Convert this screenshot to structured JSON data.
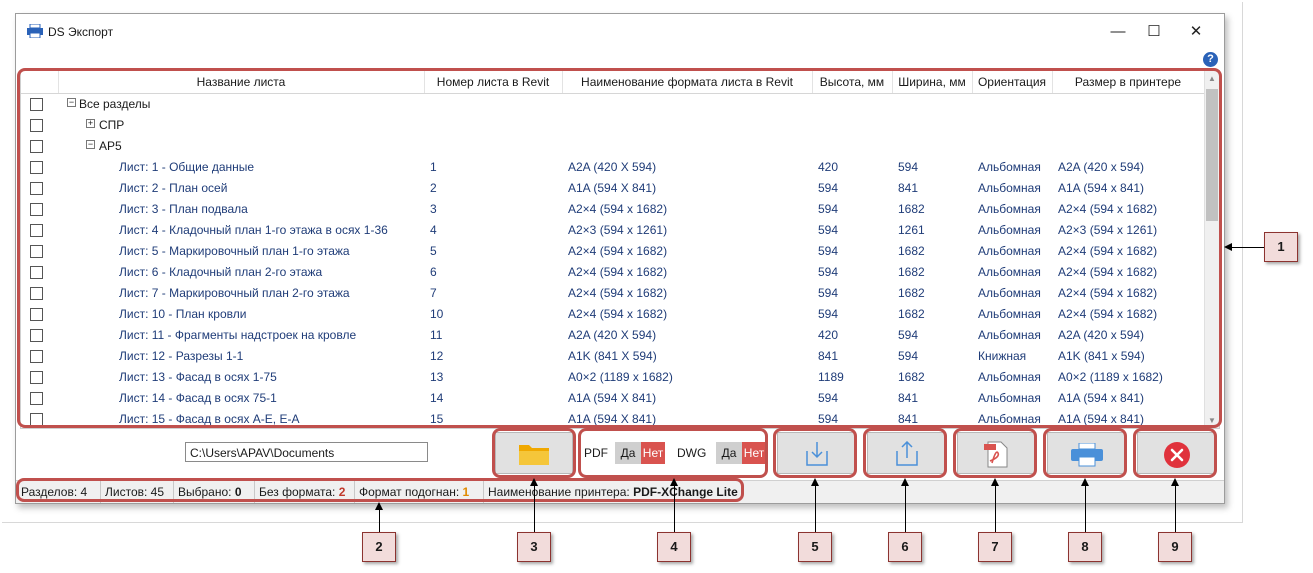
{
  "window": {
    "title": "DS Экспорт",
    "minimize": "—",
    "maximize": "☐",
    "close": "✕",
    "help": "?"
  },
  "colors": {
    "highlight": "#c0504d",
    "callout_fill": "#f2dcdb",
    "toggle_no": "#d9534f",
    "sheet_text": "#1f3c78",
    "folder": "#f5b81c",
    "export_blue": "#4a90d9",
    "close_red": "#e0323c"
  },
  "table": {
    "headers": [
      "Название листа",
      "Номер листа в Revit",
      "Наименование формата листа в Revit",
      "Высота, мм",
      "Ширина, мм",
      "Ориентация",
      "Размер в принтере"
    ],
    "groups": [
      {
        "label": "Все разделы",
        "expander": "−"
      },
      {
        "label": "СПР",
        "expander": "+"
      },
      {
        "label": "АР5",
        "expander": "−"
      }
    ],
    "rows": [
      {
        "name": "Лист: 1 - Общие данные",
        "number": "1",
        "format": "A2A (420 X 594)",
        "height": "420",
        "width": "594",
        "orientation": "Альбомная",
        "printer_size": "A2A (420 x 594)"
      },
      {
        "name": "Лист: 2 - План осей",
        "number": "2",
        "format": "A1A (594 X 841)",
        "height": "594",
        "width": "841",
        "orientation": "Альбомная",
        "printer_size": "A1A (594 x 841)"
      },
      {
        "name": "Лист: 3 - План подвала",
        "number": "3",
        "format": "A2×4 (594 x 1682)",
        "height": "594",
        "width": "1682",
        "orientation": "Альбомная",
        "printer_size": "A2×4 (594 x 1682)"
      },
      {
        "name": "Лист: 4 - Кладочный план 1-го этажа в осях 1-36",
        "number": "4",
        "format": "A2×3 (594 x 1261)",
        "height": "594",
        "width": "1261",
        "orientation": "Альбомная",
        "printer_size": "A2×3 (594 x 1261)"
      },
      {
        "name": "Лист: 5 - Маркировочный план 1-го этажа",
        "number": "5",
        "format": "A2×4 (594 x 1682)",
        "height": "594",
        "width": "1682",
        "orientation": "Альбомная",
        "printer_size": "A2×4 (594 x 1682)"
      },
      {
        "name": "Лист: 6 - Кладочный план 2-го этажа",
        "number": "6",
        "format": "A2×4 (594 x 1682)",
        "height": "594",
        "width": "1682",
        "orientation": "Альбомная",
        "printer_size": "A2×4 (594 x 1682)"
      },
      {
        "name": "Лист: 7 - Маркировочный план 2-го этажа",
        "number": "7",
        "format": "A2×4 (594 x 1682)",
        "height": "594",
        "width": "1682",
        "orientation": "Альбомная",
        "printer_size": "A2×4 (594 x 1682)"
      },
      {
        "name": "Лист: 10 - План кровли",
        "number": "10",
        "format": "A2×4 (594 x 1682)",
        "height": "594",
        "width": "1682",
        "orientation": "Альбомная",
        "printer_size": "A2×4 (594 x 1682)"
      },
      {
        "name": "Лист: 11 - Фрагменты надстроек на кровле",
        "number": "11",
        "format": "A2A (420 X 594)",
        "height": "420",
        "width": "594",
        "orientation": "Альбомная",
        "printer_size": "A2A (420 x 594)"
      },
      {
        "name": "Лист: 12 - Разрезы 1-1",
        "number": "12",
        "format": "A1K (841 X 594)",
        "height": "841",
        "width": "594",
        "orientation": "Книжная",
        "printer_size": "A1K (841 x 594)"
      },
      {
        "name": "Лист: 13 - Фасад в осях 1-75",
        "number": "13",
        "format": "A0×2 (1189 x 1682)",
        "height": "1189",
        "width": "1682",
        "orientation": "Альбомная",
        "printer_size": "A0×2 (1189 x 1682)"
      },
      {
        "name": "Лист: 14 - Фасад в осях 75-1",
        "number": "14",
        "format": "A1A (594 X 841)",
        "height": "594",
        "width": "841",
        "orientation": "Альбомная",
        "printer_size": "A1A (594 x 841)"
      },
      {
        "name": "Лист: 15 - Фасад в осях А-Е, Е-А",
        "number": "15",
        "format": "A1A (594 X 841)",
        "height": "594",
        "width": "841",
        "orientation": "Альбомная",
        "printer_size": "A1A (594 x 841)"
      }
    ]
  },
  "toolbar": {
    "path_value": "C:\\Users\\APAV\\Documents",
    "pdf_label": "PDF",
    "dwg_label": "DWG",
    "yes_label": "Да",
    "no_label": "Нет"
  },
  "status": {
    "sections_label": "Разделов:",
    "sections_value": "4",
    "sheets_label": "Листов:",
    "sheets_value": "45",
    "selected_label": "Выбрано:",
    "selected_value": "0",
    "noformat_label": "Без формата:",
    "noformat_value": "2",
    "fitted_label": "Формат подогнан:",
    "fitted_value": "1",
    "printer_label": "Наименование принтера:",
    "printer_value": "PDF-XChange Lite"
  },
  "callouts": [
    "1",
    "2",
    "3",
    "4",
    "5",
    "6",
    "7",
    "8",
    "9"
  ]
}
